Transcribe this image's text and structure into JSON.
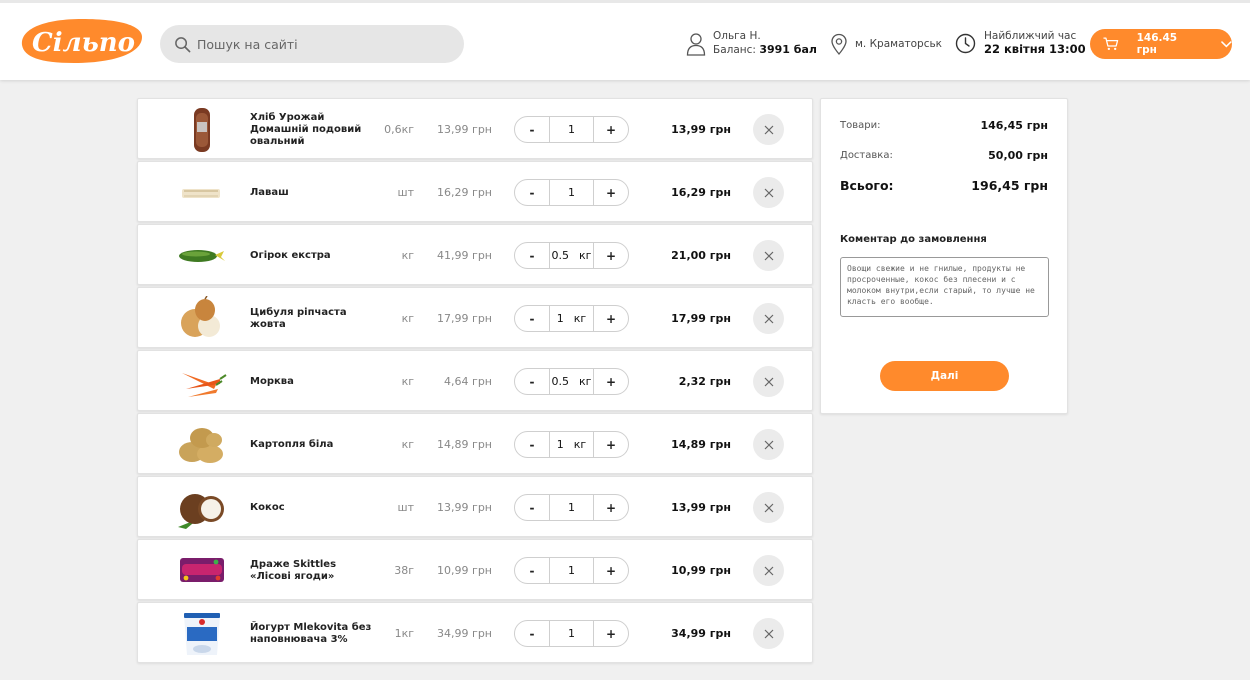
{
  "header": {
    "logo_text": "Сільпо",
    "search_placeholder": "Пошук на сайті",
    "user_name": "Ольга Н.",
    "balance_label": "Баланс:",
    "balance_value": "3991 бал",
    "location": "м. Краматорськ",
    "time_label": "Найближчий час",
    "time_value": "22 квітня 13:00",
    "cart_amount": "146.45 грн"
  },
  "items": [
    {
      "name": "Хліб Урожай Домашній подовий овальний",
      "unit": "0,6кг",
      "price": "13,99 грн",
      "qty": "1",
      "qty_unit": "",
      "total": "13,99 грн",
      "icon": "bread-icon"
    },
    {
      "name": "Лаваш",
      "unit": "шт",
      "price": "16,29 грн",
      "qty": "1",
      "qty_unit": "",
      "total": "16,29 грн",
      "icon": "lavash-icon"
    },
    {
      "name": "Огірок екстра",
      "unit": "кг",
      "price": "41,99 грн",
      "qty": "0.5",
      "qty_unit": "кг",
      "total": "21,00 грн",
      "icon": "cucumber-icon"
    },
    {
      "name": "Цибуля ріпчаста жовта",
      "unit": "кг",
      "price": "17,99 грн",
      "qty": "1",
      "qty_unit": "кг",
      "total": "17,99 грн",
      "icon": "onion-icon"
    },
    {
      "name": "Морква",
      "unit": "кг",
      "price": "4,64 грн",
      "qty": "0.5",
      "qty_unit": "кг",
      "total": "2,32 грн",
      "icon": "carrot-icon"
    },
    {
      "name": "Картопля біла",
      "unit": "кг",
      "price": "14,89 грн",
      "qty": "1",
      "qty_unit": "кг",
      "total": "14,89 грн",
      "icon": "potato-icon"
    },
    {
      "name": "Кокос",
      "unit": "шт",
      "price": "13,99 грн",
      "qty": "1",
      "qty_unit": "",
      "total": "13,99 грн",
      "icon": "coconut-icon"
    },
    {
      "name": "Драже Skittles «Лісові ягоди»",
      "unit": "38г",
      "price": "10,99 грн",
      "qty": "1",
      "qty_unit": "",
      "total": "10,99 грн",
      "icon": "skittles-icon"
    },
    {
      "name": "Йогурт Mlekovita без наповнювача 3%",
      "unit": "1кг",
      "price": "34,99 грн",
      "qty": "1",
      "qty_unit": "",
      "total": "34,99 грн",
      "icon": "yogurt-icon"
    }
  ],
  "qty_controls": {
    "minus": "-",
    "plus": "+"
  },
  "summary": {
    "goods_label": "Товари:",
    "goods_value": "146,45 грн",
    "delivery_label": "Доставка:",
    "delivery_value": "50,00 грн",
    "total_label": "Всього:",
    "total_value": "196,45 грн",
    "comment_label": "Коментар до замовлення",
    "comment_text": "Овощи свежие и не гнилые, продукты не просроченные, кокос без плесени и с молоком внутри,если старый, то лучше не класть его вообще.",
    "next_label": "Далі"
  },
  "colors": {
    "accent": "#ff8a2c",
    "background": "#f0f0f0"
  }
}
